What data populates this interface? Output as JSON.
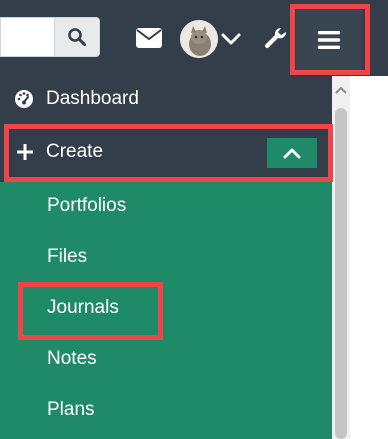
{
  "header": {
    "search": {
      "value": "",
      "placeholder": ""
    },
    "icons": {
      "search": "search-icon",
      "mail": "envelope-icon",
      "avatar": "user-avatar",
      "user_menu": "chevron-down-icon",
      "admin": "wrench-icon",
      "menu": "hamburger-menu-icon"
    }
  },
  "sidebar": {
    "dashboard": {
      "label": "Dashboard",
      "icon": "dashboard-icon"
    },
    "create": {
      "label": "Create",
      "icon": "plus-icon",
      "toggle_icon": "chevron-up-icon"
    },
    "create_items": [
      {
        "label": "Portfolios"
      },
      {
        "label": "Files"
      },
      {
        "label": "Journals"
      },
      {
        "label": "Notes"
      },
      {
        "label": "Plans"
      }
    ]
  },
  "colors": {
    "header_bg": "#343e4a",
    "submenu_bg": "#1f8a68",
    "highlight": "#f0434a",
    "text": "#ffffff"
  }
}
